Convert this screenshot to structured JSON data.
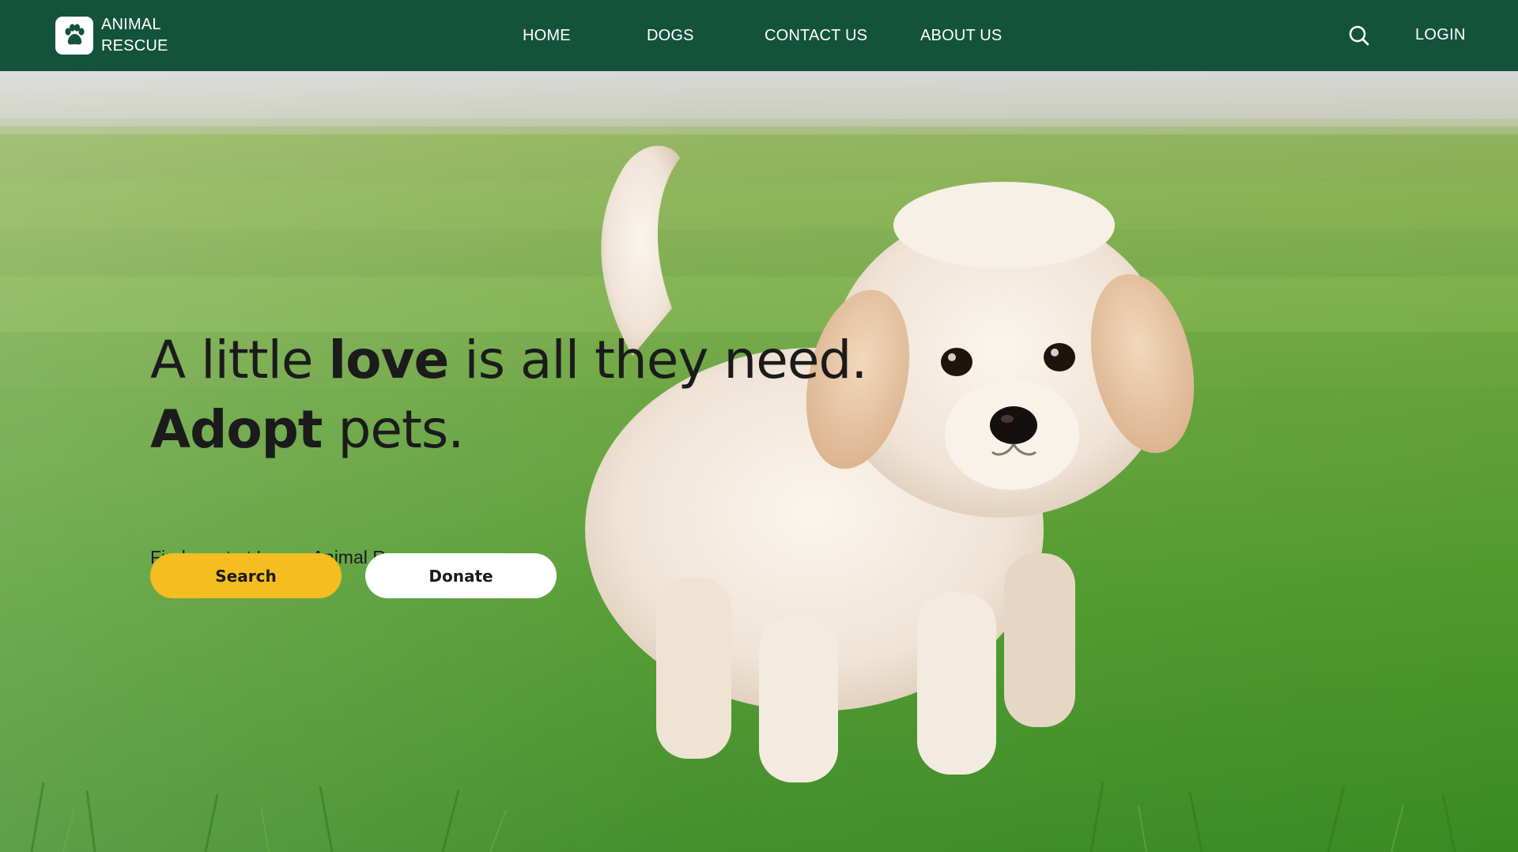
{
  "brand": {
    "logo_icon": "paw-icon",
    "name_line1": "ANIMAL",
    "name_line2": "RESCUE"
  },
  "nav": {
    "items": [
      {
        "label": "HOME"
      },
      {
        "label": "DOGS"
      },
      {
        "label": "CONTACT US"
      },
      {
        "label": "ABOUT US"
      }
    ],
    "search_icon": "search-icon",
    "login_label": "LOGIN"
  },
  "hero": {
    "headline": {
      "line1_part1": "A little ",
      "line1_bold": "love",
      "line1_part2": " is all they need.",
      "line2_bold": "Adopt",
      "line2_part2": " pets."
    },
    "subtitle": "Find a pet at Lorem Animal Rescue",
    "primary_button": "Search",
    "secondary_button": "Donate",
    "image": "fluffy cream-colored puppy standing on green grass"
  },
  "colors": {
    "nav_bg": "#14533b",
    "primary_button": "#f5bd1f",
    "secondary_button": "#ffffff",
    "text_dark": "#1b1b1b",
    "nav_text": "#ffffff"
  }
}
